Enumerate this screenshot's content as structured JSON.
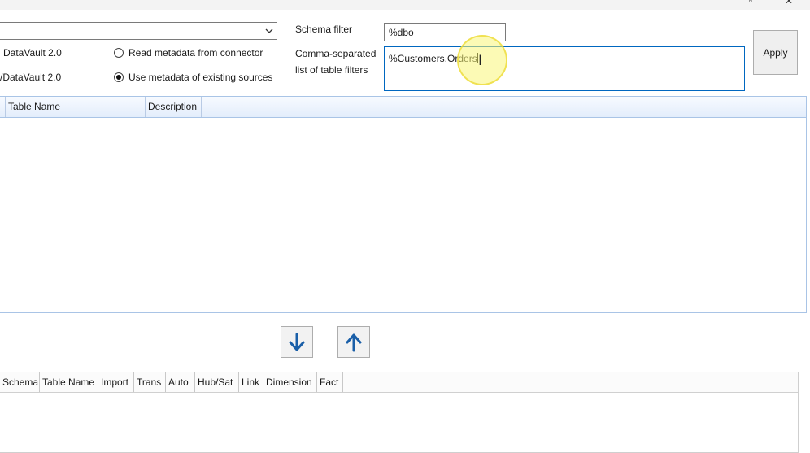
{
  "window": {
    "maximize_icon": "restore-icon",
    "close_icon": "close-icon"
  },
  "options": {
    "model_option_1": "DataVault 2.0",
    "model_option_2": "/DataVault 2.0",
    "read_metadata_label": "Read metadata from connector",
    "use_metadata_label": "Use metadata of existing sources",
    "selected": "use_metadata"
  },
  "filters": {
    "schema_label": "Schema filter",
    "schema_value": "%dbo",
    "table_filter_label_line1": "Comma-separated",
    "table_filter_label_line2": "list of table filters",
    "table_filter_value": "%Customers,Orders",
    "apply_label": "Apply"
  },
  "source_grid": {
    "columns": [
      "",
      "Table Name",
      "Description"
    ]
  },
  "move_buttons": {
    "down_icon": "arrow-down-icon",
    "up_icon": "arrow-up-icon"
  },
  "target_grid": {
    "columns": [
      "Schema",
      "Table Name",
      "Import",
      "Trans",
      "Auto",
      "Hub/Sat",
      "Link",
      "Dimension",
      "Fact"
    ]
  },
  "colors": {
    "accent": "#0067c0",
    "arrow": "#1a5fa8",
    "grid_header": "#e3edfb",
    "cursor_highlight": "#faf578"
  }
}
